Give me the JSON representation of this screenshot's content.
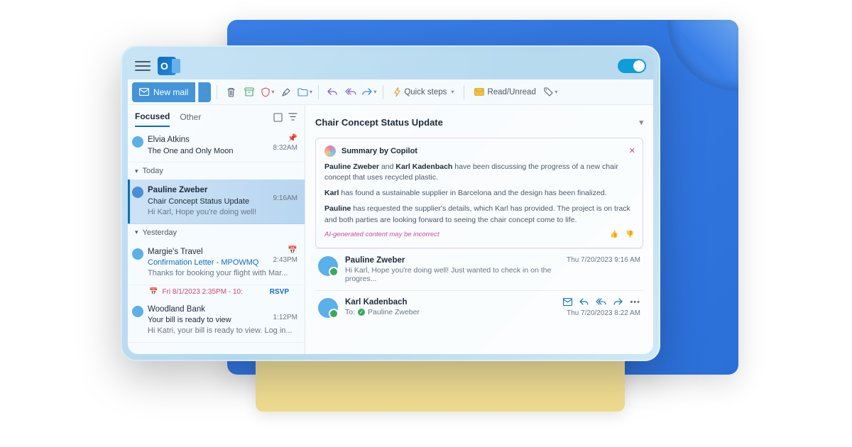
{
  "toolbar": {
    "new_mail": "New mail",
    "quick_steps": "Quick steps",
    "read_unread": "Read/Unread"
  },
  "tabs": {
    "focused": "Focused",
    "other": "Other"
  },
  "groups": {
    "today": "Today",
    "yesterday": "Yesterday"
  },
  "mail_items": [
    {
      "sender": "Elvia Atkins",
      "subject": "The One and Only Moon",
      "time": "8:32AM",
      "avatar": "#5ab0e8"
    },
    {
      "sender": "Pauline Zweber",
      "subject": "Chair Concept Status Update",
      "preview": "Hi Karl, Hope you're doing well!",
      "time": "9:16AM",
      "avatar": "#4a8dd8"
    },
    {
      "sender": "Margie's Travel",
      "subject": "Confirmation Letter - MPOWMQ",
      "preview": "Thanks for booking your flight with Mar...",
      "time": "2:43PM",
      "avatar": "#5ab0e8"
    },
    {
      "sender": "Woodland Bank",
      "subject": "Your bill is ready to view",
      "preview": "Hi Katri, your bill is ready to view. Log in...",
      "time": "1:12PM",
      "avatar": "#5ab0e8"
    }
  ],
  "rsvp": {
    "date": "Fri 8/1/2023 2:35PM - 10:",
    "label": "RSVP"
  },
  "reading": {
    "subject": "Chair Concept Status Update",
    "copilot": {
      "title": "Summary by Copilot",
      "p1_a": "Pauline Zweber",
      "p1_b": " and ",
      "p1_c": "Karl Kadenbach",
      "p1_d": " have been discussing the progress of a new chair concept that uses recycled plastic.",
      "p2_a": "Karl",
      "p2_b": " has found a sustainable supplier in Barcelona and the design has been finalized.",
      "p3_a": "Pauline",
      "p3_b": " has requested the supplier's details, which Karl has provided. The project is on track and both parties are looking forward to seeing the chair concept come to life.",
      "disclaimer": "AI-generated content may be incorrect"
    },
    "thread": [
      {
        "sender": "Pauline Zweber",
        "preview": "Hi Karl, Hope you're doing well!  Just wanted to check in on the progres...",
        "time": "Thu 7/20/2023 9:16 AM"
      },
      {
        "sender": "Karl Kadenbach",
        "to_label": "To:",
        "to_name": "Pauline Zweber",
        "time": "Thu 7/20/2023 8:22 AM"
      }
    ]
  }
}
